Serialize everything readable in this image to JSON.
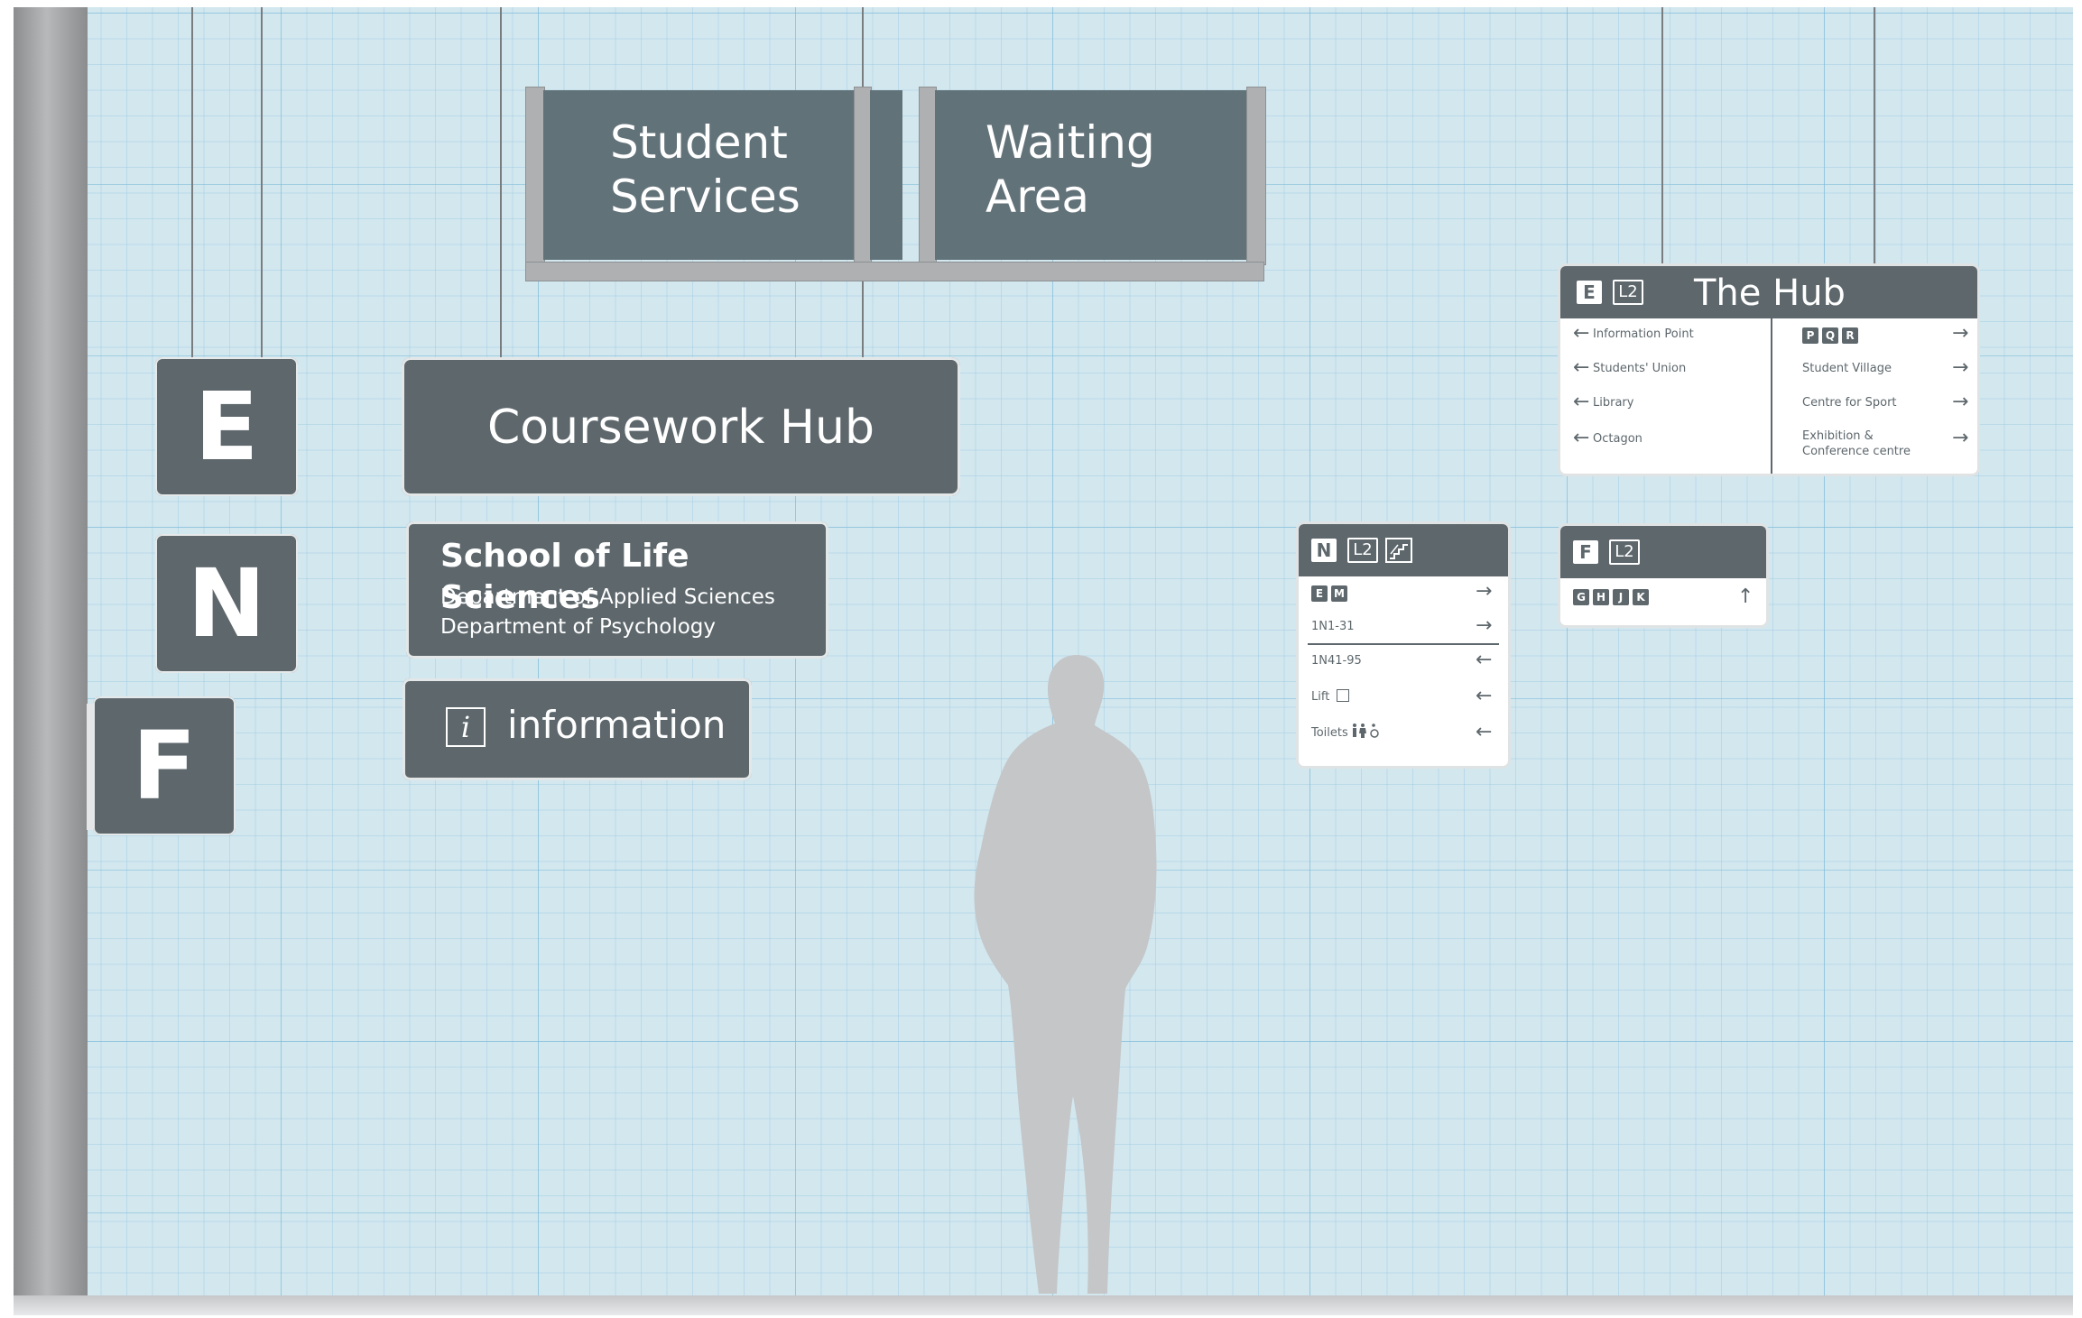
{
  "overhead_frame": {
    "left_label": "Student\nServices",
    "right_label": "Waiting\nArea"
  },
  "zone_signs": [
    "E",
    "N",
    "F"
  ],
  "coursework_hub": {
    "label": "Coursework Hub"
  },
  "school_sign": {
    "title": "School of Life Sciences",
    "lines": [
      "Department of Applied Sciences",
      "Department of Psychology"
    ]
  },
  "info_sign": {
    "icon_letter": "i",
    "label": "information"
  },
  "hub_panel": {
    "zone": "E",
    "level": "L2",
    "title": "The Hub",
    "left_items": [
      "Information Point",
      "Students' Union",
      "Library",
      "Octagon"
    ],
    "right_chips": [
      "P",
      "Q",
      "R"
    ],
    "right_items": [
      "Student Village",
      "Centre for Sport",
      "Exhibition &\nConference centre"
    ]
  },
  "n_panel": {
    "zone": "N",
    "level": "L2",
    "rows": [
      {
        "chips": [
          "E",
          "M"
        ],
        "text": "",
        "arrow": "→"
      },
      {
        "chips": [],
        "text": "1N1-31",
        "arrow": "→"
      },
      {
        "chips": [],
        "text": "1N41-95",
        "arrow": "←"
      },
      {
        "chips": [],
        "text": "Lift",
        "arrow": "←"
      },
      {
        "chips": [],
        "text": "Toilets",
        "arrow": "←"
      }
    ]
  },
  "f_panel": {
    "zone": "F",
    "level": "L2",
    "chips": [
      "G",
      "H",
      "J",
      "K"
    ],
    "arrow": "↑"
  },
  "colors": {
    "sign_grey": "#5d676c",
    "grid_blue": "#d3e7ef",
    "silhouette": "#c4c6c7"
  }
}
